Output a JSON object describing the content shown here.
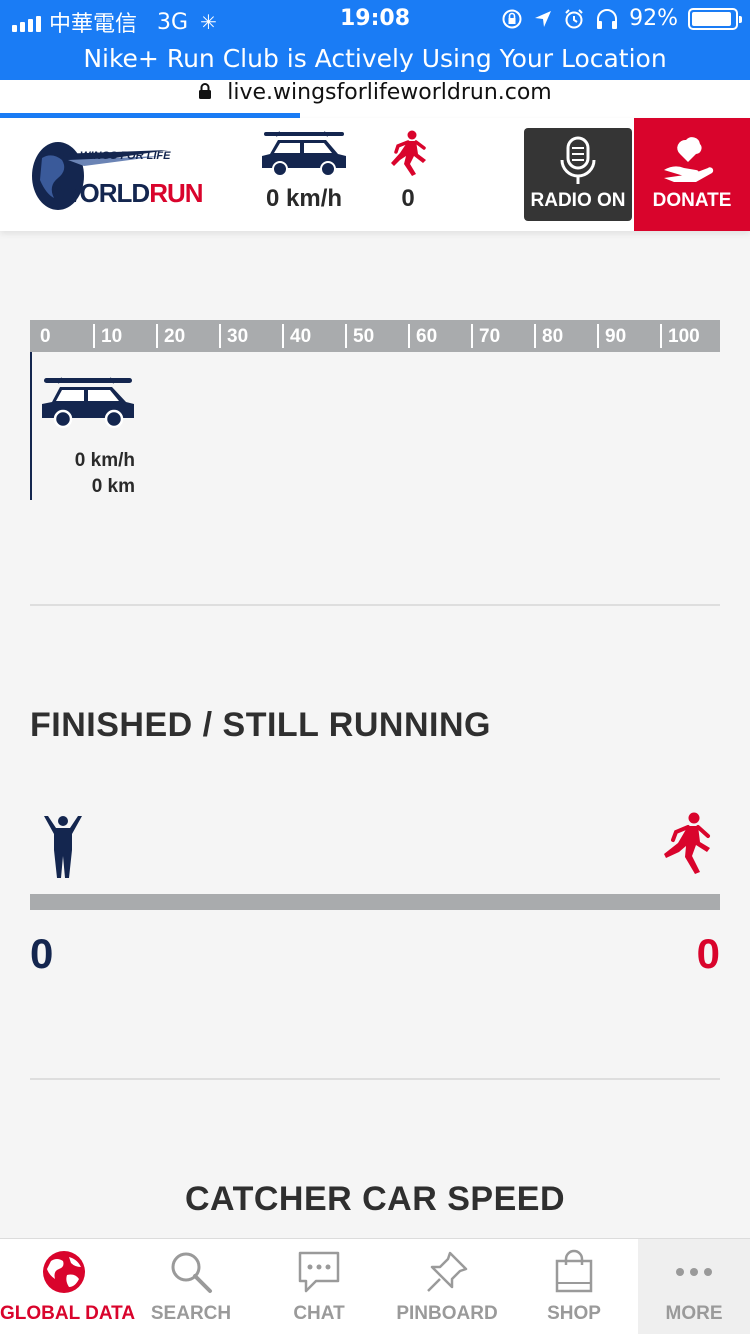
{
  "status_bar": {
    "carrier": "中華電信",
    "network": "3G",
    "time": "19:08",
    "battery": "92%",
    "battery_level": 0.92
  },
  "banner": {
    "text": "Nike+ Run Club is Actively Using Your Location"
  },
  "browser": {
    "url": "live.wingsforlifeworldrun.com"
  },
  "header": {
    "logo": {
      "wings": "WINGS FOR LIFE",
      "world": "WORLD",
      "run": "RUN"
    },
    "car_speed": "0 km/h",
    "runners": "0",
    "radio_label": "RADIO ON",
    "donate_label": "DONATE"
  },
  "distance_scale": {
    "ticks": [
      "0",
      "10",
      "20",
      "30",
      "40",
      "50",
      "60",
      "70",
      "80",
      "90",
      "100"
    ],
    "car_speed": "0 km/h",
    "car_distance": "0 km"
  },
  "finished_section": {
    "title": "FINISHED / STILL RUNNING",
    "finished_count": "0",
    "running_count": "0"
  },
  "catcher_section": {
    "title": "CATCHER CAR SPEED"
  },
  "tabs": [
    {
      "label": "GLOBAL DATA",
      "icon": "globe-icon",
      "active": true
    },
    {
      "label": "SEARCH",
      "icon": "search-icon",
      "active": false
    },
    {
      "label": "CHAT",
      "icon": "chat-icon",
      "active": false
    },
    {
      "label": "PINBOARD",
      "icon": "pin-icon",
      "active": false
    },
    {
      "label": "SHOP",
      "icon": "shopping-bag-icon",
      "active": false
    },
    {
      "label": "MORE",
      "icon": "more-icon",
      "active": false
    }
  ],
  "colors": {
    "ios_blue": "#1a7cf5",
    "brand_red": "#d9042c",
    "brand_navy": "#14264f",
    "scale_gray": "#a9abad"
  }
}
